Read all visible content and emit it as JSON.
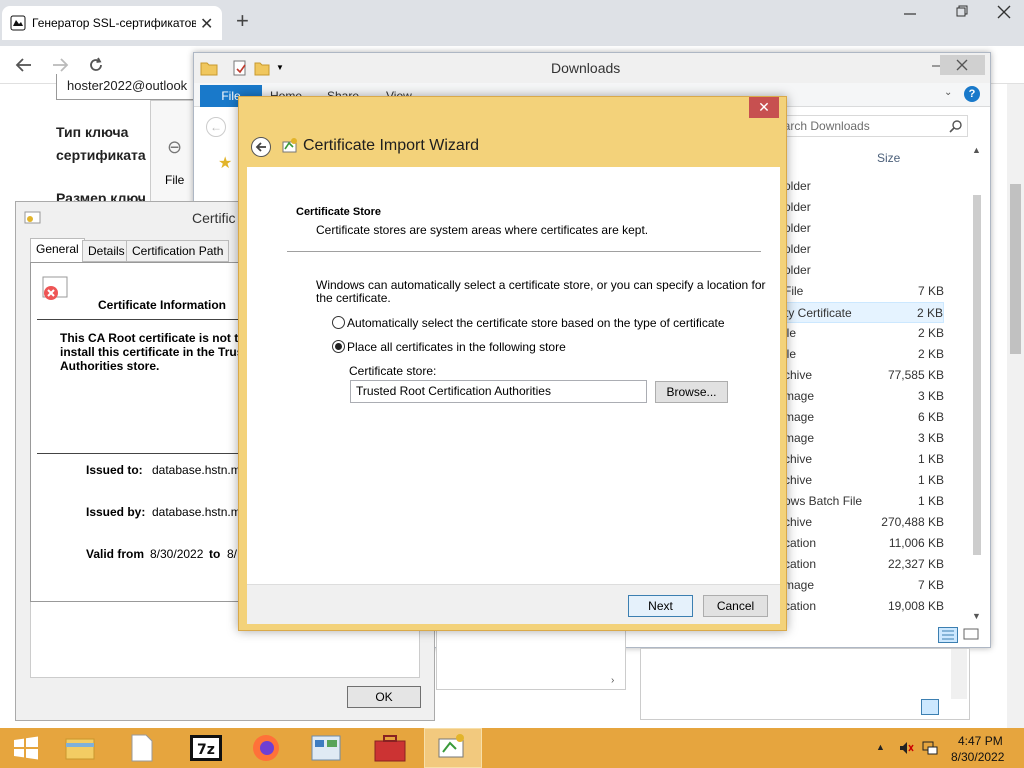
{
  "browser": {
    "tab_title": "Генератор SSL-сертификатов |",
    "new_tab_symbol": "+",
    "page": {
      "email_value": "hoster2022@outlook",
      "label_key_type_1": "Тип ключа",
      "label_key_type_2": "сертификата",
      "label_key_size": "Размер ключ"
    }
  },
  "explorer": {
    "title": "Downloads",
    "ribbon_tabs": [
      "File",
      "Home",
      "Share",
      "View"
    ],
    "search_placeholder": "earch Downloads",
    "size_header": "Size",
    "files": [
      {
        "type": "older",
        "size": ""
      },
      {
        "type": "older",
        "size": ""
      },
      {
        "type": "older",
        "size": ""
      },
      {
        "type": "older",
        "size": ""
      },
      {
        "type": "older",
        "size": ""
      },
      {
        "type": "File",
        "size": "7 KB"
      },
      {
        "type": "ty Certificate",
        "size": "2 KB"
      },
      {
        "type": "ile",
        "size": "2 KB"
      },
      {
        "type": "ile",
        "size": "2 KB"
      },
      {
        "type": "chive",
        "size": "77,585 KB"
      },
      {
        "type": "mage",
        "size": "3 KB"
      },
      {
        "type": "mage",
        "size": "6 KB"
      },
      {
        "type": "mage",
        "size": "3 KB"
      },
      {
        "type": "chive",
        "size": "1 KB"
      },
      {
        "type": "chive",
        "size": "1 KB"
      },
      {
        "type": "ows Batch File",
        "size": "1 KB"
      },
      {
        "type": "chive",
        "size": "270,488 KB"
      },
      {
        "type": "cation",
        "size": "11,006 KB"
      },
      {
        "type": "cation",
        "size": "22,327 KB"
      },
      {
        "type": "mage",
        "size": "7 KB"
      },
      {
        "type": "cation",
        "size": "19,008 KB"
      }
    ]
  },
  "back_window": {
    "file_label": "File"
  },
  "cert_dialog": {
    "title": "Certific",
    "tabs": [
      "General",
      "Details",
      "Certification Path"
    ],
    "heading": "Certificate Information",
    "warning_lines": [
      "This CA Root certificate is not tr",
      "install this certificate in the Trus",
      "Authorities store."
    ],
    "issued_to_label": "Issued to:",
    "issued_to_value": "database.hstn.me",
    "issued_by_label": "Issued by:",
    "issued_by_value": "database.hstn.me",
    "valid_from_label": "Valid from",
    "valid_from_value": "8/30/2022",
    "valid_to_label": "to",
    "valid_to_value": "8/",
    "ok_label": "OK"
  },
  "wizard": {
    "title": "Certificate Import Wizard",
    "section_title": "Certificate Store",
    "section_desc": "Certificate stores are system areas where certificates are kept.",
    "intro_line1": "Windows can automatically select a certificate store, or you can specify a location for",
    "intro_line2": "the certificate.",
    "option_auto": "Automatically select the certificate store based on the type of certificate",
    "option_place": "Place all certificates in the following store",
    "selected_option": "place",
    "store_label": "Certificate store:",
    "store_value": "Trusted Root Certification Authorities",
    "browse_label": "Browse...",
    "next_label": "Next",
    "cancel_label": "Cancel"
  },
  "taskbar": {
    "time": "4:47 PM",
    "date": "8/30/2022",
    "apps": [
      "start-button",
      "file-explorer",
      "notepad-document",
      "7zip",
      "firefox",
      "control-panel",
      "toolbox",
      "certificate-wizard"
    ]
  },
  "colors": {
    "taskbar": "#e6a53e",
    "wizard_frame": "#f3d27a",
    "accent_blue": "#1979ca",
    "close_red": "#c75050"
  }
}
